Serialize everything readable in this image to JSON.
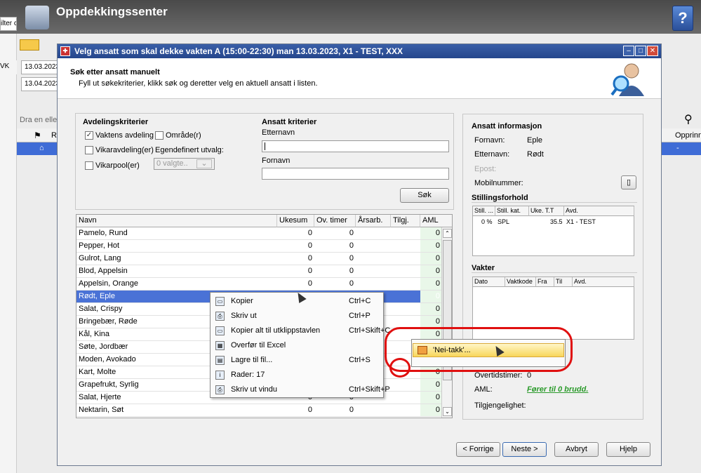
{
  "app": {
    "title": "Oppdekkingssenter",
    "help_icon": "?"
  },
  "left_strip": {
    "filter_label": "ilter c",
    "vk_label": "VK"
  },
  "background": {
    "date_from": "13.03.2023",
    "date_to": "13.04.2023",
    "group_hint": "Dra en eller t",
    "col_r": "Re",
    "col_opprinn": "Opprinn",
    "row_dash": "-"
  },
  "dialog": {
    "title": "Velg ansatt som skal dekke vakten A (15:00-22:30) man 13.03.2023, X1 - TEST, XXX",
    "header_title": "Søk etter ansatt manuelt",
    "header_sub": "Fyll ut søkekriterier, klikk søk og deretter velg en aktuell ansatt i listen.",
    "dept": {
      "title": "Avdelingskriterier",
      "cb1": "Vaktens avdeling",
      "cb2": "Område(r)",
      "cb3": "Vikaravdeling(er)",
      "custom": "Egendefinert utvalg:",
      "cb4": "Vikarpool(er)",
      "select": "0 valgte.."
    },
    "emp": {
      "title": "Ansatt kriterier",
      "lastname_label": "Etternavn",
      "firstname_label": "Fornavn",
      "search_btn": "Søk"
    },
    "grid": {
      "headers": [
        "Navn",
        "Ukesum",
        "Ov. timer",
        "Årsarb.",
        "Tilgj.",
        "AML"
      ],
      "rows": [
        {
          "n": "Pamelo, Rund",
          "u": "0",
          "o": "0",
          "a": "0"
        },
        {
          "n": "Pepper, Hot",
          "u": "0",
          "o": "0",
          "a": "0"
        },
        {
          "n": "Gulrot, Lang",
          "u": "0",
          "o": "0",
          "a": "0"
        },
        {
          "n": "Blod, Appelsin",
          "u": "0",
          "o": "0",
          "a": "0"
        },
        {
          "n": "Appelsin, Orange",
          "u": "0",
          "o": "0",
          "a": "0"
        },
        {
          "n": "Rødt, Eple",
          "u": "",
          "o": "",
          "a": "0"
        },
        {
          "n": "Salat, Crispy",
          "u": "",
          "o": "",
          "a": "0"
        },
        {
          "n": "Bringebær, Røde",
          "u": "",
          "o": "",
          "a": "0"
        },
        {
          "n": "Kål, Kina",
          "u": "",
          "o": "",
          "a": "0"
        },
        {
          "n": "Søte, Jordbær",
          "u": "",
          "o": "",
          "a": "0"
        },
        {
          "n": "Moden, Avokado",
          "u": "",
          "o": "",
          "a": "0"
        },
        {
          "n": "Kart, Molte",
          "u": "",
          "o": "",
          "a": "0"
        },
        {
          "n": "Grapefrukt, Syrlig",
          "u": "",
          "o": "",
          "a": "0"
        },
        {
          "n": "Salat, Hjerte",
          "u": "0",
          "o": "0",
          "a": "0"
        },
        {
          "n": "Nektarin, Søt",
          "u": "0",
          "o": "0",
          "a": "0"
        }
      ]
    },
    "info": {
      "title": "Ansatt informasjon",
      "fornavn_label": "Fornavn:",
      "fornavn": "Eple",
      "etternavn_label": "Etternavn:",
      "etternavn": "Rødt",
      "epost_label": "Epost:",
      "mobil_label": "Mobilnummer:",
      "stilling_title": "Stillingsforhold",
      "stilling_headers": [
        "Still. ...",
        "Still. kat.",
        "Uke. T.T",
        "Avd."
      ],
      "stilling_row": [
        "0 %",
        "SPL",
        "35.5",
        "X1 - TEST"
      ],
      "vakter_title": "Vakter",
      "vakter_headers": [
        "Dato",
        "Vaktkode",
        "Fra",
        "Til",
        "Avd."
      ],
      "overtid_label": "Overtidstimer:",
      "overtid": "0",
      "aml_label": "AML:",
      "aml": "Fører til 0 brudd.",
      "tilgj_label": "Tilgjengelighet:"
    },
    "footer": {
      "prev": "< Forrige",
      "next": "Neste >",
      "cancel": "Avbryt",
      "help": "Hjelp"
    }
  },
  "context_menu": [
    {
      "t": "Kopier",
      "k": "Ctrl+C"
    },
    {
      "t": "Skriv ut",
      "k": "Ctrl+P"
    },
    {
      "t": "Kopier alt til utklippstavlen",
      "k": "Ctrl+Skift+C"
    },
    {
      "t": "Overfør til Excel",
      "k": ""
    },
    {
      "t": "Lagre til fil...",
      "k": "Ctrl+S"
    },
    {
      "t": "Rader: 17",
      "k": ""
    },
    {
      "t": "Skriv ut vindu",
      "k": "Ctrl+Skift+P"
    }
  ],
  "submenu": {
    "item": "'Nei-takk'..."
  },
  "colors": {
    "title_bar": "#25468c",
    "selection": "#4a72d6",
    "highlight": "#f8d65a",
    "annotation": "#e01010",
    "aml_ok": "#2a9a2a"
  }
}
